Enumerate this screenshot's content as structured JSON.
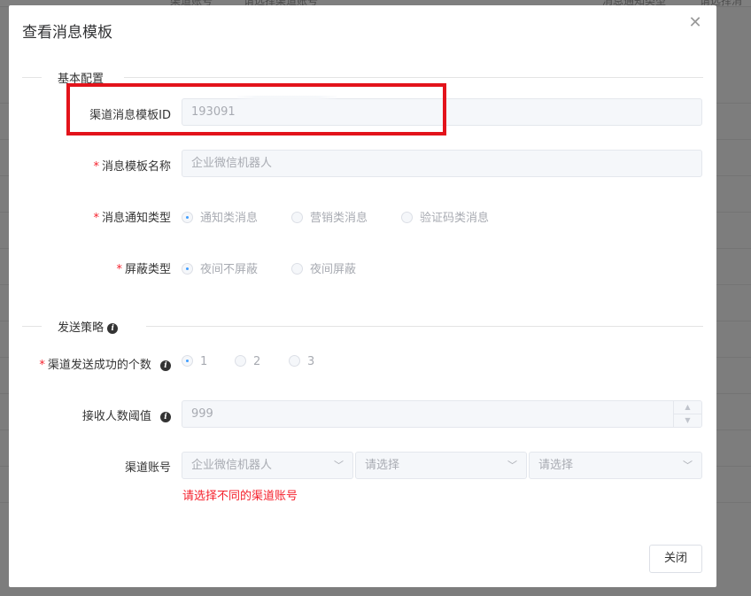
{
  "background": {
    "filter_labels": [
      "渠道账号",
      "请选择渠道账号",
      "消息通知类型",
      "请选择消息"
    ]
  },
  "modal": {
    "title": "查看消息模板",
    "sections": {
      "basic": "基本配置",
      "strategy": "发送策略"
    },
    "fields": {
      "template_id": {
        "label": "渠道消息模板ID",
        "value": "193091"
      },
      "template_name": {
        "label": "消息模板名称",
        "required": "*",
        "value": "企业微信机器人"
      },
      "notify_type": {
        "label": "消息通知类型",
        "required": "*",
        "options": [
          "通知类消息",
          "营销类消息",
          "验证码类消息"
        ],
        "selected": 0
      },
      "shield_type": {
        "label": "屏蔽类型",
        "required": "*",
        "options": [
          "夜间不屏蔽",
          "夜间屏蔽"
        ],
        "selected": 0
      },
      "success_count": {
        "label": "渠道发送成功的个数",
        "required": "*",
        "options": [
          "1",
          "2",
          "3"
        ],
        "selected": 0
      },
      "receiver_threshold": {
        "label": "接收人数阈值",
        "value": "999"
      },
      "channel_account": {
        "label": "渠道账号",
        "selects": [
          "企业微信机器人",
          "请选择",
          "请选择"
        ],
        "error": "请选择不同的渠道账号"
      }
    },
    "close_button": "关闭"
  },
  "colors": {
    "accent": "#409eff",
    "error": "#f5222d",
    "highlight_box": "#e3131b"
  },
  "icons": {
    "close": "close-icon",
    "info": "info-icon",
    "chevron": "chevron-down-icon"
  }
}
